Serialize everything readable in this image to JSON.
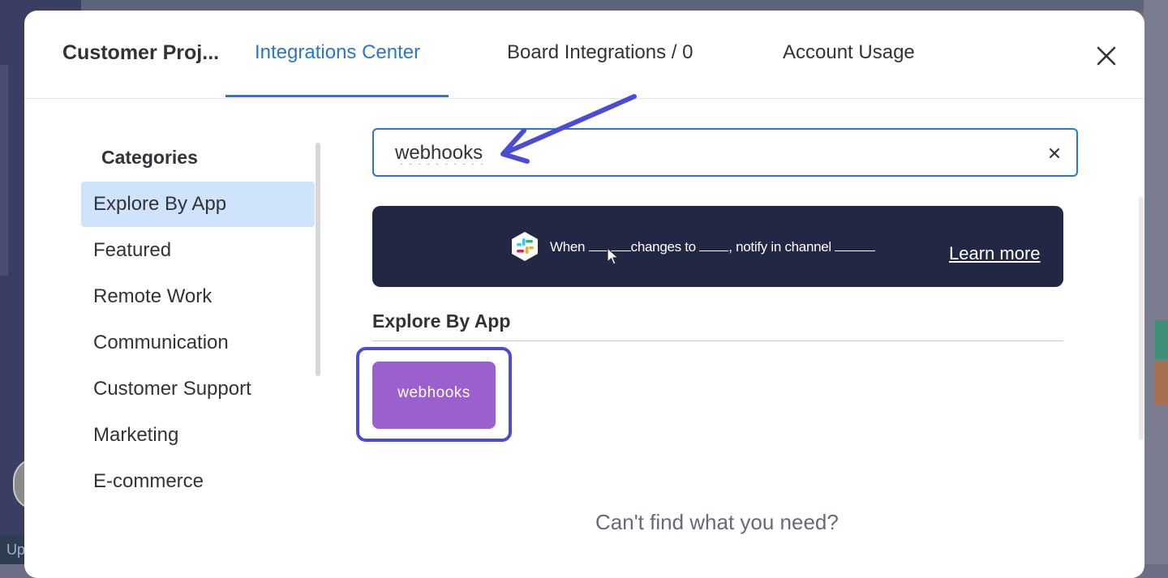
{
  "modal": {
    "board_title": "Customer Proj...",
    "tabs": [
      {
        "label": "Integrations Center",
        "active": true
      },
      {
        "label": "Board Integrations / 0",
        "active": false
      },
      {
        "label": "Account Usage",
        "active": false
      }
    ],
    "close_icon": "close-icon"
  },
  "sidebar": {
    "title": "Categories",
    "items": [
      {
        "label": "Explore By App",
        "selected": true
      },
      {
        "label": "Featured"
      },
      {
        "label": "Remote Work"
      },
      {
        "label": "Communication"
      },
      {
        "label": "Customer Support"
      },
      {
        "label": "Marketing"
      },
      {
        "label": "E-commerce"
      }
    ]
  },
  "search": {
    "value": "webhooks",
    "clear_icon": "clear-icon"
  },
  "banner": {
    "text_when": "When",
    "text_changes": "changes to",
    "text_notify": ", notify in channel",
    "learn_more": "Learn more"
  },
  "section": {
    "title": "Explore By App"
  },
  "apps": [
    {
      "label": "webhooks",
      "color": "#9b5fce"
    }
  ],
  "footer": {
    "cant_find": "Can't find what you need?"
  },
  "colors": {
    "accent": "#2a76cf",
    "highlight": "#4b4cd6",
    "banner_bg": "#222744"
  },
  "background": {
    "partial_text": "Up"
  }
}
